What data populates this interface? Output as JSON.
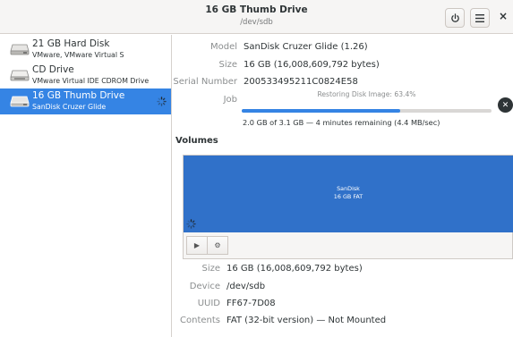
{
  "window": {
    "title": "16 GB Thumb Drive",
    "subtitle": "/dev/sdb",
    "power_icon": "power-icon",
    "menu_icon": "hamburger-menu-icon",
    "close_label": "×"
  },
  "sidebar": {
    "drives": [
      {
        "name": "21 GB Hard Disk",
        "sub": "VMware, VMware Virtual S",
        "icon": "hard-disk-icon",
        "selected": false
      },
      {
        "name": "CD Drive",
        "sub": "VMware Virtual IDE CDROM Drive",
        "icon": "optical-drive-icon",
        "selected": false
      },
      {
        "name": "16 GB Thumb Drive",
        "sub": "SanDisk Cruzer Glide",
        "icon": "usb-drive-icon",
        "selected": true,
        "busy": true
      }
    ]
  },
  "drive_info": {
    "model_label": "Model",
    "model_value": "SanDisk Cruzer Glide (1.26)",
    "size_label": "Size",
    "size_value": "16 GB (16,008,609,792 bytes)",
    "serial_label": "Serial Number",
    "serial_value": "200533495211C0824E58",
    "job_label": "Job",
    "job_status": "Restoring Disk Image: 63.4%",
    "job_progress": 0.634,
    "job_detail": "2.0 GB of 3.1 GB — 4 minutes remaining (4.4 MB/sec)",
    "cancel_icon": "cancel-icon"
  },
  "volumes": {
    "heading": "Volumes",
    "block": {
      "name": "SanDisk",
      "desc": "16 GB FAT",
      "color": "#3071c9"
    },
    "toolbar": [
      {
        "icon": "play-icon",
        "glyph": "▶"
      },
      {
        "icon": "settings-gears-icon",
        "glyph": "⚙"
      }
    ]
  },
  "volume_info": {
    "size_label": "Size",
    "size_value": "16 GB (16,008,609,792 bytes)",
    "device_label": "Device",
    "device_value": "/dev/sdb",
    "uuid_label": "UUID",
    "uuid_value": "FF67-7D08",
    "contents_label": "Contents",
    "contents_value": "FAT (32-bit version) — Not Mounted"
  },
  "colors": {
    "accent": "#3584e4",
    "volume_fill": "#3071c9",
    "label_gray": "#8b8e8f"
  }
}
